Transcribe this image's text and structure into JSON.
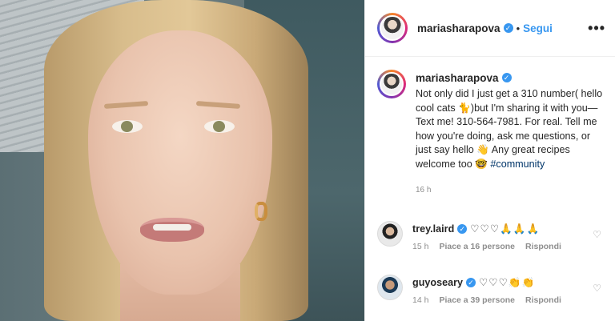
{
  "post": {
    "username": "mariasharapova",
    "follow_label": "Segui",
    "separator": "•",
    "more_label": "•••",
    "caption": "Not only did I just get a 310 number( hello cool cats 🐈)but I'm sharing it with you—Text me! 310-564-7981. For real. Tell me how you're doing, ask me questions, or just say hello 👋 Any great recipes welcome too 🤓",
    "hashtag": "#community",
    "time_ago": "16 h"
  },
  "comments": [
    {
      "username": "trey.laird",
      "text": "♡♡♡🙏🙏🙏",
      "time": "15 h",
      "likes": "Piace a 16 persone",
      "reply": "Rispondi"
    },
    {
      "username": "guyoseary",
      "text": "♡♡♡👏👏",
      "time": "14 h",
      "likes": "Piace a 39 persone",
      "reply": "Rispondi"
    }
  ],
  "icons": {
    "verified": "verified-badge-icon",
    "heart": "heart-icon",
    "more": "more-options-icon"
  },
  "colors": {
    "accent": "#3897f0",
    "muted": "#8e8e8e",
    "text": "#262626"
  }
}
